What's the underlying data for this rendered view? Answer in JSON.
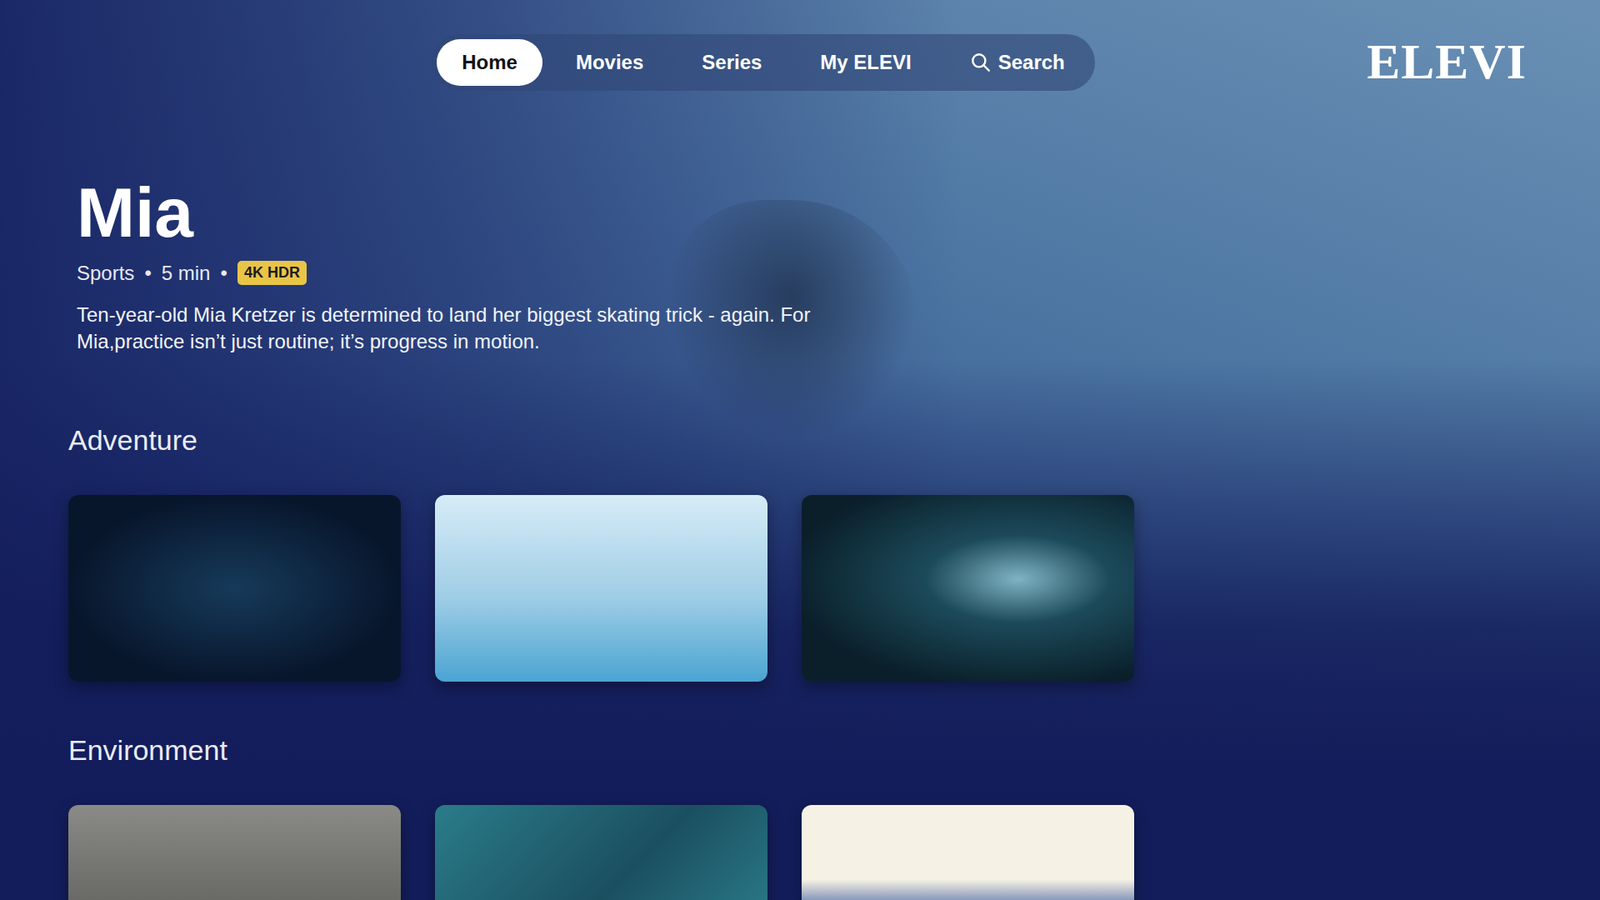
{
  "logo": "ELEVI",
  "nav": {
    "tabs": [
      {
        "label": "Home",
        "selected": true
      },
      {
        "label": "Movies",
        "selected": false
      },
      {
        "label": "Series",
        "selected": false
      },
      {
        "label": "My ELEVI",
        "selected": false
      }
    ],
    "search": {
      "label": "Search"
    }
  },
  "hero": {
    "title": "Mia",
    "genre": "Sports",
    "separator": "•",
    "duration": "5 min",
    "badge": "4K HDR",
    "description": "Ten-year-old Mia Kretzer is determined to land her biggest skating trick - again. For Mia,practice isn’t just routine; it’s progress in motion."
  },
  "sections": [
    {
      "title": "Adventure",
      "cards": [
        {},
        {},
        {}
      ]
    },
    {
      "title": "Environment",
      "cards": [
        {},
        {},
        {}
      ]
    }
  ]
}
